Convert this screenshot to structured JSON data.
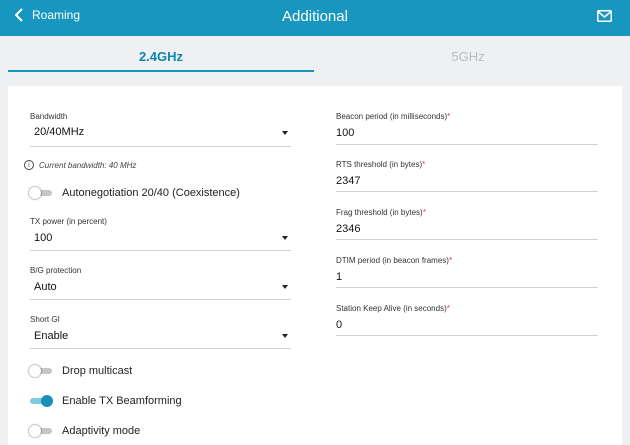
{
  "header": {
    "back_label": "Roaming",
    "title": "Additional"
  },
  "tabs": [
    {
      "label": "2.4GHz",
      "active": true
    },
    {
      "label": "5GHz",
      "active": false
    }
  ],
  "left": {
    "bandwidth": {
      "label": "Bandwidth",
      "value": "20/40MHz"
    },
    "current_bandwidth": "Current bandwidth: 40 MHz",
    "autonegotiation": {
      "label": "Autonegotiation 20/40 (Coexistence)",
      "on": false
    },
    "tx_power": {
      "label": "TX power (in percent)",
      "value": "100"
    },
    "bg_protection": {
      "label": "B/G protection",
      "value": "Auto"
    },
    "short_gi": {
      "label": "Short GI",
      "value": "Enable"
    },
    "drop_multicast": {
      "label": "Drop multicast",
      "on": false
    },
    "tx_beamforming": {
      "label": "Enable TX Beamforming",
      "on": true
    },
    "adaptivity": {
      "label": "Adaptivity mode",
      "on": false
    }
  },
  "right": {
    "beacon_period": {
      "label": "Beacon period (in milliseconds)",
      "value": "100"
    },
    "rts_threshold": {
      "label": "RTS threshold (in bytes)",
      "value": "2347"
    },
    "frag_threshold": {
      "label": "Frag threshold (in bytes)",
      "value": "2346"
    },
    "dtim_period": {
      "label": "DTIM period (in beacon frames)",
      "value": "1"
    },
    "station_keep_alive": {
      "label": "Station Keep Alive (in seconds)",
      "value": "0"
    },
    "required_mark": "*"
  },
  "colors": {
    "header": "#1797bf",
    "accent": "#0f84ad",
    "background": "#eef0f2",
    "required": "#e53935"
  },
  "icons": {
    "back": "chevron-left-icon",
    "mail": "mail-icon",
    "info": "info-icon"
  }
}
